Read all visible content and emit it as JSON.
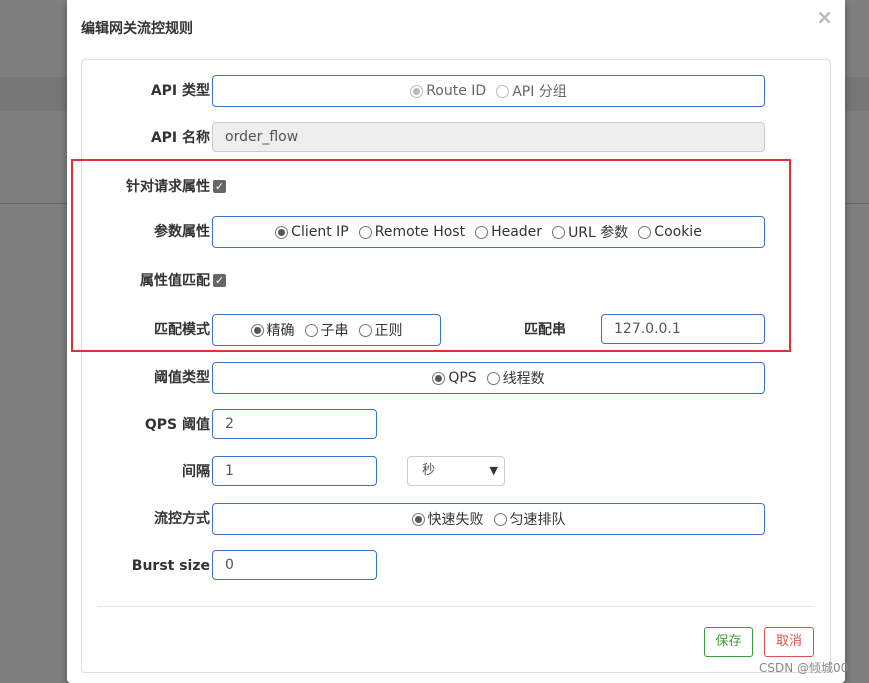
{
  "modal": {
    "title": "编辑网关流控规则",
    "close": "×"
  },
  "form": {
    "api_type": {
      "label": "API 类型",
      "options": [
        "Route ID",
        "API 分组"
      ],
      "selected": "Route ID"
    },
    "api_name": {
      "label": "API 名称",
      "value": "order_flow"
    },
    "request_attr": {
      "label": "针对请求属性",
      "checked": true
    },
    "param_attr": {
      "label": "参数属性",
      "options": [
        "Client IP",
        "Remote Host",
        "Header",
        "URL 参数",
        "Cookie"
      ],
      "selected": "Client IP"
    },
    "attr_match": {
      "label": "属性值匹配",
      "checked": true
    },
    "match_mode": {
      "label": "匹配模式",
      "options": [
        "精确",
        "子串",
        "正则"
      ],
      "selected": "精确"
    },
    "match_string": {
      "label": "匹配串",
      "value": "127.0.0.1"
    },
    "threshold_type": {
      "label": "阈值类型",
      "options": [
        "QPS",
        "线程数"
      ],
      "selected": "QPS"
    },
    "qps_threshold": {
      "label": "QPS 阈值",
      "value": "2"
    },
    "interval": {
      "label": "间隔",
      "value": "1",
      "unit": "秒"
    },
    "control_mode": {
      "label": "流控方式",
      "options": [
        "快速失败",
        "匀速排队"
      ],
      "selected": "快速失败"
    },
    "burst_size": {
      "label": "Burst size",
      "value": "0"
    }
  },
  "footer": {
    "save": "保存",
    "cancel": "取消"
  },
  "watermark": "CSDN @倾城00",
  "colors": {
    "accent_border": "#3a73c4",
    "highlight": "#e0303a",
    "save": "#3c9b3c",
    "cancel": "#d9534f"
  }
}
